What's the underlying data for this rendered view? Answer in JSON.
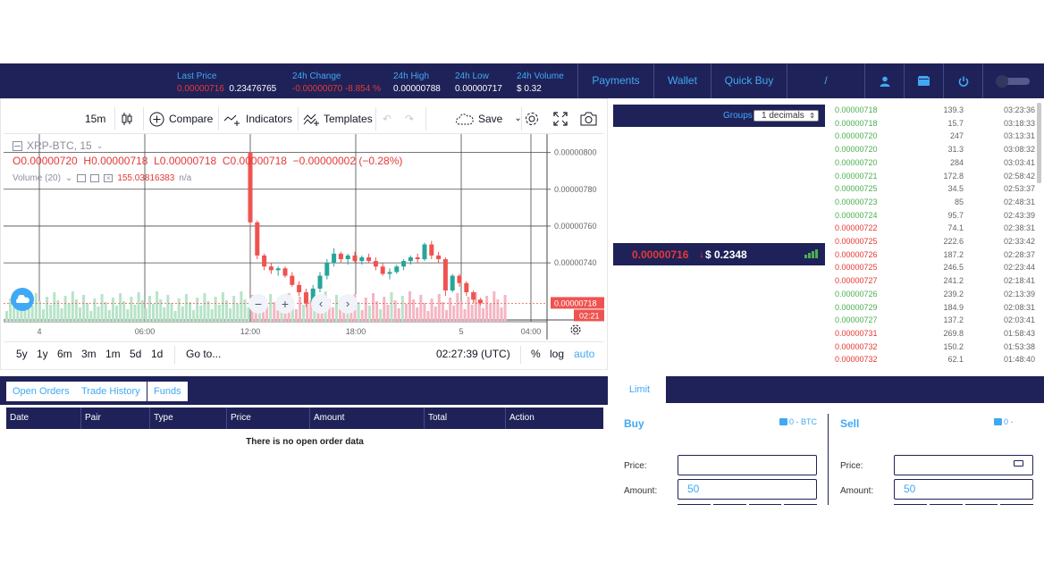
{
  "stats": {
    "last_price_label": "Last Price",
    "last_price_red": "0.00000716",
    "last_price_usd": "0.23476765",
    "change_label": "24h Change",
    "change_value": "-0.00000070",
    "change_percent": "-8.854 %",
    "high_label": "24h High",
    "high_value": "0.00000788",
    "low_label": "24h Low",
    "low_value": "0.00000717",
    "volume_label": "24h Volume",
    "volume_value": "$ 0.32"
  },
  "nav": {
    "payments": "Payments",
    "wallet": "Wallet",
    "quick_buy": "Quick Buy",
    "slash": "/"
  },
  "chart_toolbar": {
    "interval": "15m",
    "compare": "Compare",
    "indicators": "Indicators",
    "templates": "Templates",
    "save": "Save"
  },
  "chart_legend": {
    "symbol": "XRP-BTC, 15",
    "ohlc": "O0.00000720  H0.00000718  L0.00000718  C0.00000718  −0.00000002 (−0.28%)",
    "volume": "Volume (20)",
    "volume_value": "155.03816383",
    "volume_na": "n/a"
  },
  "chart_bottom": {
    "ranges": [
      "5y",
      "1y",
      "6m",
      "3m",
      "1m",
      "5d",
      "1d"
    ],
    "goto": "Go to...",
    "time": "02:27:39 (UTC)",
    "percent": "%",
    "log": "log",
    "auto": "auto"
  },
  "chart_data": {
    "type": "candlestick",
    "symbol": "XRP-BTC",
    "interval": "15",
    "y_ticks": [
      "0.00000800",
      "0.00000780",
      "0.00000760",
      "0.00000740"
    ],
    "x_ticks": [
      "4",
      "06:00",
      "12:00",
      "18:00",
      "5",
      "04:00"
    ],
    "last_price_label": "0.00000718",
    "countdown": "02:21",
    "ylim": [
      7.08e-06,
      8.1e-06
    ],
    "candles": [
      [
        8e-06,
        8e-06,
        7.6e-06,
        7.62e-06
      ],
      [
        7.62e-06,
        7.63e-06,
        7.42e-06,
        7.44e-06
      ],
      [
        7.44e-06,
        7.45e-06,
        7.36e-06,
        7.38e-06
      ],
      [
        7.38e-06,
        7.4e-06,
        7.34e-06,
        7.36e-06
      ],
      [
        7.36e-06,
        7.38e-06,
        7.33e-06,
        7.37e-06
      ],
      [
        7.37e-06,
        7.38e-06,
        7.32e-06,
        7.33e-06
      ],
      [
        7.33e-06,
        7.35e-06,
        7.27e-06,
        7.28e-06
      ],
      [
        7.28e-06,
        7.3e-06,
        7.22e-06,
        7.24e-06
      ],
      [
        7.24e-06,
        7.26e-06,
        7.16e-06,
        7.18e-06
      ],
      [
        7.18e-06,
        7.28e-06,
        7.16e-06,
        7.26e-06
      ],
      [
        7.26e-06,
        7.35e-06,
        7.24e-06,
        7.33e-06
      ],
      [
        7.33e-06,
        7.42e-06,
        7.31e-06,
        7.4e-06
      ],
      [
        7.4e-06,
        7.48e-06,
        7.38e-06,
        7.45e-06
      ],
      [
        7.45e-06,
        7.46e-06,
        7.4e-06,
        7.42e-06
      ],
      [
        7.42e-06,
        7.45e-06,
        7.39e-06,
        7.44e-06
      ],
      [
        7.44e-06,
        7.46e-06,
        7.4e-06,
        7.41e-06
      ],
      [
        7.41e-06,
        7.44e-06,
        7.39e-06,
        7.43e-06
      ],
      [
        7.43e-06,
        7.45e-06,
        7.4e-06,
        7.41e-06
      ],
      [
        7.41e-06,
        7.43e-06,
        7.36e-06,
        7.38e-06
      ],
      [
        7.38e-06,
        7.4e-06,
        7.33e-06,
        7.34e-06
      ],
      [
        7.34e-06,
        7.37e-06,
        7.31e-06,
        7.35e-06
      ],
      [
        7.35e-06,
        7.39e-06,
        7.34e-06,
        7.38e-06
      ],
      [
        7.38e-06,
        7.42e-06,
        7.36e-06,
        7.41e-06
      ],
      [
        7.41e-06,
        7.44e-06,
        7.39e-06,
        7.43e-06
      ],
      [
        7.43e-06,
        7.45e-06,
        7.4e-06,
        7.42e-06
      ],
      [
        7.42e-06,
        7.51e-06,
        7.41e-06,
        7.5e-06
      ],
      [
        7.5e-06,
        7.52e-06,
        7.42e-06,
        7.44e-06
      ],
      [
        7.44e-06,
        7.46e-06,
        7.4e-06,
        7.42e-06
      ],
      [
        7.42e-06,
        7.43e-06,
        7.22e-06,
        7.25e-06
      ],
      [
        7.25e-06,
        7.34e-06,
        7.24e-06,
        7.33e-06
      ],
      [
        7.33e-06,
        7.34e-06,
        7.27e-06,
        7.29e-06
      ],
      [
        7.29e-06,
        7.3e-06,
        7.22e-06,
        7.24e-06
      ],
      [
        7.24e-06,
        7.25e-06,
        7.18e-06,
        7.2e-06
      ],
      [
        7.2e-06,
        7.21e-06,
        7.17e-06,
        7.18e-06
      ]
    ],
    "volume_colors": "green/red per candle"
  },
  "orderbook": {
    "groups_label": "Groups",
    "groups_value": "1 decimals",
    "last_price": "0.00000716",
    "last_usd": "$ 0.2348"
  },
  "trades": [
    {
      "price": "0.00000718",
      "amount": "139.3",
      "time": "03:23:36",
      "side": "buy"
    },
    {
      "price": "0.00000718",
      "amount": "15.7",
      "time": "03:18:33",
      "side": "buy"
    },
    {
      "price": "0.00000720",
      "amount": "247",
      "time": "03:13:31",
      "side": "buy"
    },
    {
      "price": "0.00000720",
      "amount": "31.3",
      "time": "03:08:32",
      "side": "buy"
    },
    {
      "price": "0.00000720",
      "amount": "284",
      "time": "03:03:41",
      "side": "buy"
    },
    {
      "price": "0.00000721",
      "amount": "172.8",
      "time": "02:58:42",
      "side": "buy"
    },
    {
      "price": "0.00000725",
      "amount": "34.5",
      "time": "02:53:37",
      "side": "buy"
    },
    {
      "price": "0.00000723",
      "amount": "85",
      "time": "02:48:31",
      "side": "buy"
    },
    {
      "price": "0.00000724",
      "amount": "95.7",
      "time": "02:43:39",
      "side": "buy"
    },
    {
      "price": "0.00000722",
      "amount": "74.1",
      "time": "02:38:31",
      "side": "sell"
    },
    {
      "price": "0.00000725",
      "amount": "222.6",
      "time": "02:33:42",
      "side": "sell"
    },
    {
      "price": "0.00000726",
      "amount": "187.2",
      "time": "02:28:37",
      "side": "sell"
    },
    {
      "price": "0.00000725",
      "amount": "246.5",
      "time": "02:23:44",
      "side": "sell"
    },
    {
      "price": "0.00000727",
      "amount": "241.2",
      "time": "02:18:41",
      "side": "sell"
    },
    {
      "price": "0.00000726",
      "amount": "239.2",
      "time": "02:13:39",
      "side": "buy"
    },
    {
      "price": "0.00000729",
      "amount": "184.9",
      "time": "02:08:31",
      "side": "buy"
    },
    {
      "price": "0.00000727",
      "amount": "137.2",
      "time": "02:03:41",
      "side": "buy"
    },
    {
      "price": "0.00000731",
      "amount": "269.8",
      "time": "01:58:43",
      "side": "sell"
    },
    {
      "price": "0.00000732",
      "amount": "150.2",
      "time": "01:53:38",
      "side": "sell"
    },
    {
      "price": "0.00000732",
      "amount": "62.1",
      "time": "01:48:40",
      "side": "sell"
    }
  ],
  "orders": {
    "tabs": [
      "Open Orders",
      "Trade History",
      "Funds"
    ],
    "columns": [
      "Date",
      "Pair",
      "Type",
      "Price",
      "Amount",
      "Total",
      "Action"
    ],
    "empty": "There is no open order data"
  },
  "trade_form": {
    "limit_tab": "Limit",
    "buy_label": "Buy",
    "buy_balance": "0 - BTC",
    "sell_label": "Sell",
    "sell_balance": "0 - ",
    "price_label": "Price:",
    "amount_label": "Amount:",
    "buy_amount": "50",
    "sell_amount": "50"
  },
  "colors": {
    "navy": "#1f2258",
    "accent": "#3fa9f5",
    "up": "#4caf50",
    "down": "#e53935"
  }
}
